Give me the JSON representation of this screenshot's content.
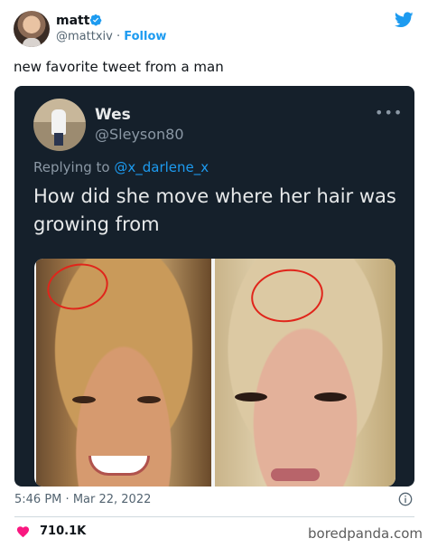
{
  "author": {
    "name": "matt",
    "handle": "@mattxiv",
    "separator": "·",
    "follow_label": "Follow"
  },
  "tweet": {
    "text": "new favorite tweet from a man"
  },
  "quoted_tweet": {
    "name": "Wes",
    "handle": "@Sleyson80",
    "replying_prefix": "Replying to",
    "replying_to": "@x_darlene_x",
    "text": "How did she move where her hair was growing from",
    "more_icon": "•••"
  },
  "footer": {
    "time": "5:46 PM",
    "separator": "·",
    "date": "Mar 22, 2022",
    "likes": "710.1K",
    "watermark": "boredpanda.com"
  },
  "icons": {
    "verified": "verified-badge-icon",
    "logo": "twitter-bird-icon",
    "info": "info-icon",
    "heart": "heart-icon",
    "more": "more-icon"
  },
  "colors": {
    "accent": "#1d9bf0",
    "heart": "#f91880",
    "card_bg": "#15202b",
    "annotation": "#e0251b"
  }
}
